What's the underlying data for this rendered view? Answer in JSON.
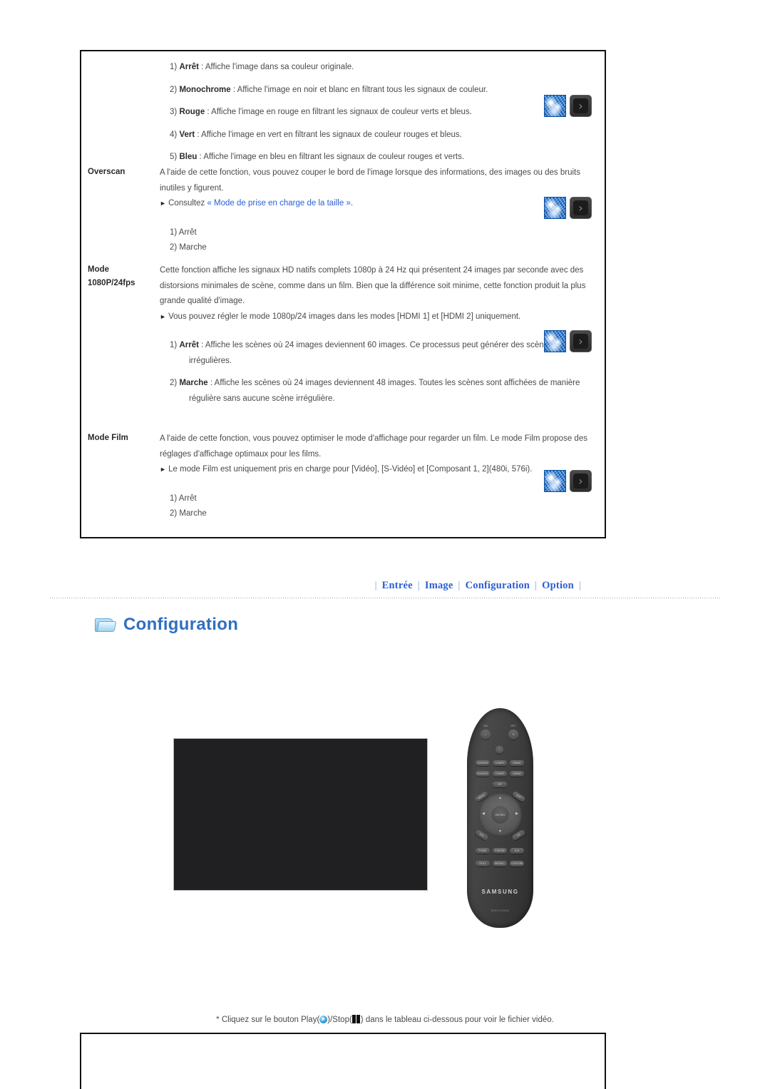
{
  "spec_table": {
    "rows": [
      {
        "label": "",
        "items": [
          {
            "num": "1)",
            "term": "Arrêt",
            "sep": " : ",
            "text": "Affiche l'image dans sa couleur originale."
          },
          {
            "num": "2)",
            "term": "Monochrome",
            "sep": " : ",
            "text": "Affiche l'image en noir et blanc en filtrant tous les signaux de couleur."
          },
          {
            "num": "3)",
            "term": "Rouge",
            "sep": " : ",
            "text": "Affiche l'image en rouge en filtrant les signaux de couleur verts et bleus."
          },
          {
            "num": "4)",
            "term": "Vert",
            "sep": " : ",
            "text": "Affiche l'image en vert en filtrant les signaux de couleur rouges et bleus."
          },
          {
            "num": "5)",
            "term": "Bleu",
            "sep": " : ",
            "text": "Affiche l'image en bleu en filtrant les signaux de couleur rouges et verts."
          }
        ]
      },
      {
        "label": "Overscan",
        "paragraph": "A l'aide de cette fonction, vous pouvez couper le bord de l'image lorsque des informations, des images ou des bruits inutiles y figurent.",
        "note_prefix": "Consultez ",
        "note_link": "« Mode de prise en charge de la taille »",
        "note_suffix": ".",
        "options": [
          "1) Arrêt",
          "2) Marche"
        ]
      },
      {
        "label": "Mode 1080P/24fps",
        "label_line1": "Mode",
        "label_line2": "1080P/24fps",
        "paragraph": "Cette fonction affiche les signaux HD natifs complets 1080p à 24 Hz qui présentent 24 images par seconde avec des distorsions minimales de scène, comme dans un film. Bien que la différence soit minime, cette fonction produit la plus grande qualité d'image.",
        "note": "Vous pouvez régler le mode 1080p/24 images dans les modes [HDMI 1] et [HDMI 2] uniquement.",
        "items": [
          {
            "num": "1)",
            "term": "Arrêt",
            "sep": " : ",
            "text": "Affiche les scènes où 24 images deviennent 60 images. Ce processus peut générer des scènes irrégulières."
          },
          {
            "num": "2)",
            "term": "Marche",
            "sep": " : ",
            "text": "Affiche les scènes où 24 images deviennent 48 images. Toutes les scènes sont affichées de manière régulière sans aucune scène irrégulière."
          }
        ]
      },
      {
        "label": "Mode Film",
        "paragraph": "A l'aide de cette fonction, vous pouvez optimiser le mode d'affichage pour regarder un film. Le mode Film propose des réglages d'affichage optimaux pour les films.",
        "note": "Le mode Film est uniquement pris en charge pour [Vidéo], [S-Vidéo] et [Composant 1, 2](480i, 576i).",
        "options": [
          "1) Arrêt",
          "2) Marche"
        ]
      }
    ],
    "thumbnails": [
      {
        "name": "video-thumbnail-1",
        "chevron": "›"
      },
      {
        "name": "video-thumbnail-2",
        "chevron": "›"
      },
      {
        "name": "video-thumbnail-3",
        "chevron": "›"
      },
      {
        "name": "video-thumbnail-4",
        "chevron": "›"
      }
    ]
  },
  "nav": {
    "separator": "|",
    "tabs": [
      {
        "label": "Entrée"
      },
      {
        "label": "Image"
      },
      {
        "label": "Configuration"
      },
      {
        "label": "Option"
      }
    ]
  },
  "section": {
    "icon": "folder-icon",
    "title": "Configuration"
  },
  "remote": {
    "brand": "SAMSUNG",
    "model": "BN59-01054A",
    "labels": {
      "on": "ON",
      "off": "OFF"
    },
    "power_on": "|",
    "power_off": "⏻",
    "info": "i",
    "enter": "ENTER",
    "buttons_row1": [
      "SOURCE",
      "COMP1",
      "HDMI1"
    ],
    "buttons_row2": [
      "SOURCE",
      "COMP2",
      "HDMI2"
    ],
    "buttons_row3": [
      "PIP"
    ],
    "buttons_row4": [
      "P.SIZE",
      "P.MODE",
      "S.M"
    ],
    "buttons_row5": [
      "STILL",
      "INSTALL",
      "CUSTOM"
    ],
    "side_left_upper": "MENU",
    "side_right_upper": "EXIT",
    "side_left_lower": "VOL",
    "side_right_lower": "CH"
  },
  "footer": {
    "prefix": "* Cliquez sur le bouton Play(",
    "middle": ")/Stop(",
    "suffix": ") dans le tableau ci-dessous pour voir le fichier vidéo."
  }
}
